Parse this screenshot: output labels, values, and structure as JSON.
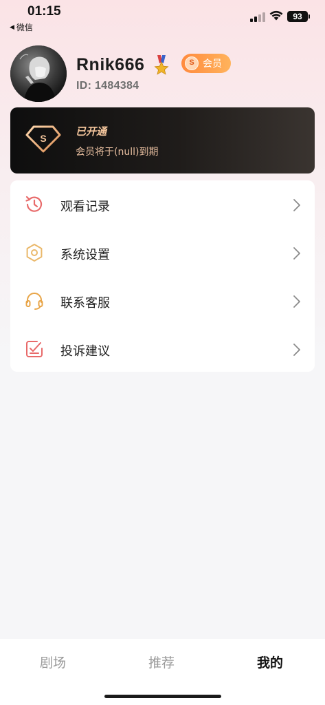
{
  "status_bar": {
    "time": "01:15",
    "back_app": "微信",
    "battery": "93"
  },
  "profile": {
    "username": "Rnik666",
    "vip_badge_letter": "S",
    "vip_badge_label": "会员",
    "user_id": "ID: 1484384"
  },
  "member_card": {
    "diamond_letter": "S",
    "title": "已开通",
    "expire_text": "会员将于(null)到期"
  },
  "menu": {
    "items": [
      {
        "label": "观看记录",
        "icon": "history-icon"
      },
      {
        "label": "系统设置",
        "icon": "settings-icon"
      },
      {
        "label": "联系客服",
        "icon": "headset-icon"
      },
      {
        "label": "投诉建议",
        "icon": "feedback-icon"
      }
    ]
  },
  "tab_bar": {
    "tabs": [
      {
        "label": "剧场",
        "active": false
      },
      {
        "label": "推荐",
        "active": false
      },
      {
        "label": "我的",
        "active": true
      }
    ]
  },
  "colors": {
    "accent_orange": "#ff8a3d",
    "member_gold": "#f3c59c",
    "history_icon": "#e86a6a",
    "settings_icon": "#eab86a",
    "headset_icon": "#e8a548",
    "feedback_icon": "#e86a6a"
  }
}
